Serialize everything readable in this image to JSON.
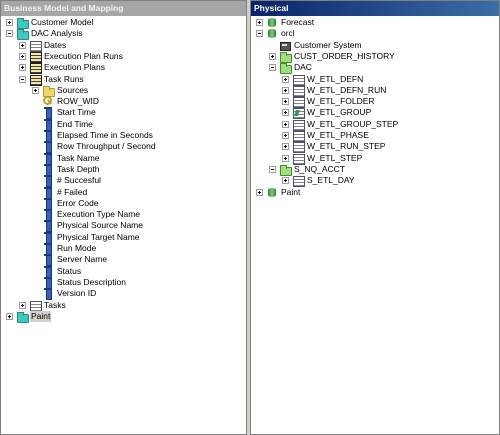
{
  "left_pane": {
    "title": "Business Model and Mapping",
    "rows": [
      {
        "id": "customer-model",
        "label": "Customer Model",
        "indent": 0,
        "expander": "plus",
        "icon": "folder-cyan-icon"
      },
      {
        "id": "dac-analysis",
        "label": "DAC Analysis",
        "indent": 0,
        "expander": "minus",
        "icon": "folder-cyan-icon"
      },
      {
        "id": "dates",
        "label": "Dates",
        "indent": 1,
        "expander": "plus",
        "icon": "table-icon"
      },
      {
        "id": "execution-plan-runs",
        "label": "Execution Plan Runs",
        "indent": 1,
        "expander": "plus",
        "icon": "fact-table-icon"
      },
      {
        "id": "execution-plans",
        "label": "Execution Plans",
        "indent": 1,
        "expander": "plus",
        "icon": "fact-table-icon"
      },
      {
        "id": "task-runs",
        "label": "Task Runs",
        "indent": 1,
        "expander": "minus",
        "icon": "fact-table-icon"
      },
      {
        "id": "sources",
        "label": "Sources",
        "indent": 2,
        "expander": "plus",
        "icon": "folder-yellow-icon"
      },
      {
        "id": "row-wid",
        "label": "ROW_WID",
        "indent": 2,
        "expander": "none",
        "icon": "key-icon"
      },
      {
        "id": "start-time",
        "label": "Start Time",
        "indent": 2,
        "expander": "none",
        "icon": "column-icon"
      },
      {
        "id": "end-time",
        "label": "End Time",
        "indent": 2,
        "expander": "none",
        "icon": "column-icon"
      },
      {
        "id": "elapsed-time",
        "label": "Elapsed Time in Seconds",
        "indent": 2,
        "expander": "none",
        "icon": "column-icon"
      },
      {
        "id": "row-throughput",
        "label": "Row Throughput / Second",
        "indent": 2,
        "expander": "none",
        "icon": "column-icon"
      },
      {
        "id": "task-name",
        "label": "Task Name",
        "indent": 2,
        "expander": "none",
        "icon": "column-icon"
      },
      {
        "id": "task-depth",
        "label": "Task Depth",
        "indent": 2,
        "expander": "none",
        "icon": "column-icon"
      },
      {
        "id": "num-succesful",
        "label": "# Succesful",
        "indent": 2,
        "expander": "none",
        "icon": "column-icon"
      },
      {
        "id": "num-failed",
        "label": "# Failed",
        "indent": 2,
        "expander": "none",
        "icon": "column-icon"
      },
      {
        "id": "error-code",
        "label": "Error Code",
        "indent": 2,
        "expander": "none",
        "icon": "column-icon"
      },
      {
        "id": "execution-type-name",
        "label": "Execution Type Name",
        "indent": 2,
        "expander": "none",
        "icon": "column-icon"
      },
      {
        "id": "physical-source-name",
        "label": "Physical Source Name",
        "indent": 2,
        "expander": "none",
        "icon": "column-icon"
      },
      {
        "id": "physical-target-name",
        "label": "Physical Target Name",
        "indent": 2,
        "expander": "none",
        "icon": "column-icon"
      },
      {
        "id": "run-mode",
        "label": "Run Mode",
        "indent": 2,
        "expander": "none",
        "icon": "column-icon"
      },
      {
        "id": "server-name",
        "label": "Server Name",
        "indent": 2,
        "expander": "none",
        "icon": "column-icon"
      },
      {
        "id": "status",
        "label": "Status",
        "indent": 2,
        "expander": "none",
        "icon": "column-icon"
      },
      {
        "id": "status-description",
        "label": "Status Description",
        "indent": 2,
        "expander": "none",
        "icon": "column-icon"
      },
      {
        "id": "version-id",
        "label": "Version ID",
        "indent": 2,
        "expander": "none",
        "icon": "column-icon"
      },
      {
        "id": "tasks",
        "label": "Tasks",
        "indent": 1,
        "expander": "plus",
        "icon": "table-icon"
      },
      {
        "id": "paint",
        "label": "Paint",
        "indent": 0,
        "expander": "plus",
        "icon": "folder-cyan-icon",
        "selected": true
      }
    ]
  },
  "right_pane": {
    "title": "Physical",
    "rows": [
      {
        "id": "forecast",
        "label": "Forecast",
        "indent": 0,
        "expander": "plus",
        "icon": "database-icon"
      },
      {
        "id": "orcl",
        "label": "orcl",
        "indent": 0,
        "expander": "minus",
        "icon": "database-icon"
      },
      {
        "id": "customer-system",
        "label": "Customer System",
        "indent": 1,
        "expander": "none",
        "icon": "connection-pool-icon"
      },
      {
        "id": "cust-order-history",
        "label": "CUST_ORDER_HISTORY",
        "indent": 1,
        "expander": "plus",
        "icon": "folder-green-icon"
      },
      {
        "id": "dac",
        "label": "DAC",
        "indent": 1,
        "expander": "minus",
        "icon": "folder-green-icon"
      },
      {
        "id": "w-etl-defn",
        "label": "W_ETL_DEFN",
        "indent": 2,
        "expander": "plus",
        "icon": "table-icon"
      },
      {
        "id": "w-etl-defn-run",
        "label": "W_ETL_DEFN_RUN",
        "indent": 2,
        "expander": "plus",
        "icon": "table-icon"
      },
      {
        "id": "w-etl-folder",
        "label": "W_ETL_FOLDER",
        "indent": 2,
        "expander": "plus",
        "icon": "table-icon"
      },
      {
        "id": "w-etl-group",
        "label": "W_ETL_GROUP",
        "indent": 2,
        "expander": "plus",
        "icon": "table-green-icon"
      },
      {
        "id": "w-etl-group-step",
        "label": "W_ETL_GROUP_STEP",
        "indent": 2,
        "expander": "plus",
        "icon": "table-icon"
      },
      {
        "id": "w-etl-phase",
        "label": "W_ETL_PHASE",
        "indent": 2,
        "expander": "plus",
        "icon": "table-icon"
      },
      {
        "id": "w-etl-run-step",
        "label": "W_ETL_RUN_STEP",
        "indent": 2,
        "expander": "plus",
        "icon": "table-icon"
      },
      {
        "id": "w-etl-step",
        "label": "W_ETL_STEP",
        "indent": 2,
        "expander": "plus",
        "icon": "table-icon"
      },
      {
        "id": "s-nq-acct",
        "label": "S_NQ_ACCT",
        "indent": 1,
        "expander": "minus",
        "icon": "folder-green-icon"
      },
      {
        "id": "s-etl-day",
        "label": "S_ETL_DAY",
        "indent": 2,
        "expander": "plus",
        "icon": "table-icon"
      },
      {
        "id": "paint-db",
        "label": "Paint",
        "indent": 0,
        "expander": "plus",
        "icon": "database-icon"
      }
    ]
  }
}
